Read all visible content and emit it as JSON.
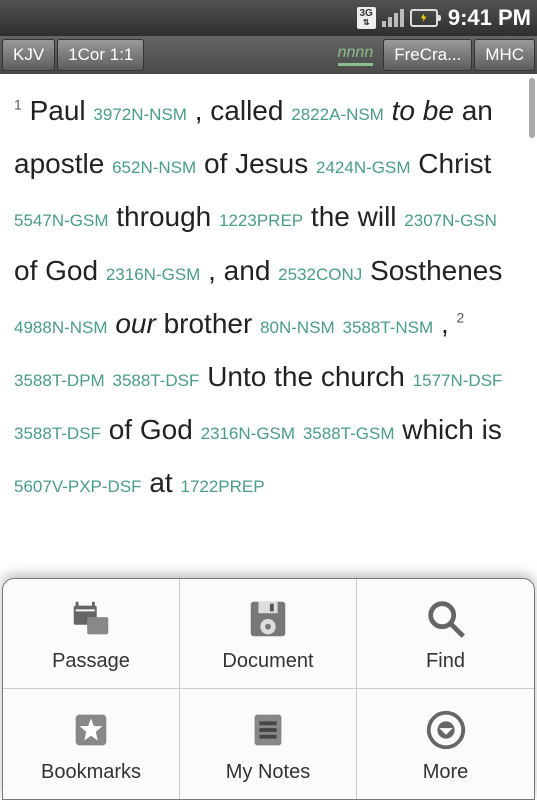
{
  "status": {
    "network": "3G",
    "time": "9:41 PM"
  },
  "toolbar": {
    "version": "KJV",
    "reference": "1Cor 1:1",
    "nnnn": "nnnn",
    "tab1": "FreCra...",
    "tab2": "MHC"
  },
  "passage": {
    "verse1": "1",
    "w_paul": "Paul",
    "c_paul": "3972N-NSM",
    "comma1": ",",
    "w_called": "called",
    "c_called": "2822A-NSM",
    "w_tobe": "to be",
    "w_apostle": "an apostle",
    "c_apostle": "652N-NSM",
    "w_ofjesus": "of Jesus",
    "c_jesus": "2424N-GSM",
    "w_christ": "Christ",
    "c_christ": "5547N-GSM",
    "w_through": "through",
    "c_through": "1223PREP",
    "w_thewill": "the will",
    "c_will": "2307N-GSN",
    "w_ofgod": "of God",
    "c_god": "2316N-GSM",
    "comma2": ",",
    "w_and": "and",
    "c_and": "2532CONJ",
    "w_sosthenes": "Sosthenes",
    "c_sosthenes": "4988N-NSM",
    "w_our": "our",
    "w_brother": "brother",
    "c_brother1": "80N-NSM",
    "c_brother2": "3588T-NSM",
    "comma3": ",",
    "verse2": "2",
    "c_3588dpm": "3588T-DPM",
    "c_3588dsf1": "3588T-DSF",
    "w_untochurch": "Unto the church",
    "c_church": "1577N-DSF",
    "c_3588dsf2": "3588T-DSF",
    "w_ofgod2": "of God",
    "c_god2": "2316N-GSM",
    "c_3588gsm": "3588T-GSM",
    "w_whichis": "which is",
    "c_whichis": "5607V-PXP-DSF",
    "w_at": "at",
    "c_at": "1722PREP"
  },
  "menu": {
    "passage": "Passage",
    "document": "Document",
    "find": "Find",
    "bookmarks": "Bookmarks",
    "mynotes": "My Notes",
    "more": "More"
  }
}
